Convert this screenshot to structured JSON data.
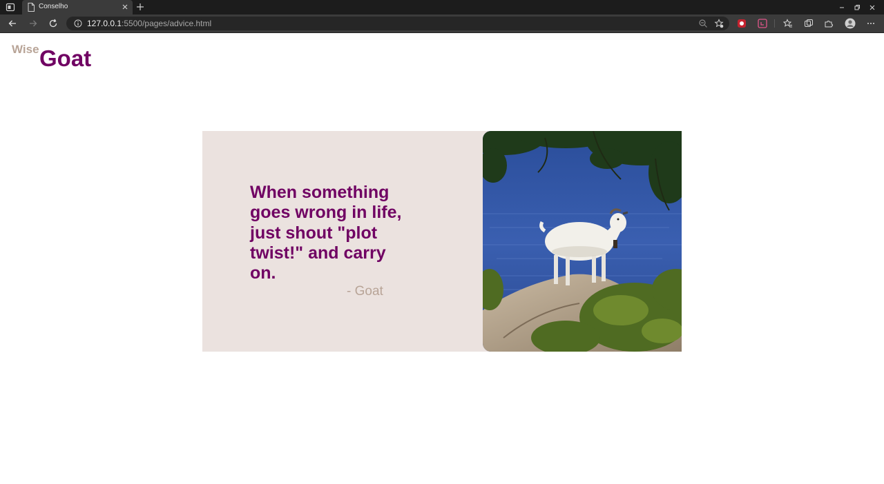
{
  "browser": {
    "tab": {
      "title": "Conselho"
    },
    "address": {
      "host": "127.0.0.1",
      "rest": ":5500/pages/advice.html"
    }
  },
  "header": {
    "logo_small": "Wise",
    "logo_big": "Goat"
  },
  "card": {
    "quote": "When something goes wrong in life, just shout \"plot twist!\" and carry on.",
    "author": "- Goat",
    "image": "goat-on-rock-by-sea-image"
  },
  "colors": {
    "brand_purple": "#700263",
    "accent_tan": "#b8a497",
    "card_bg": "#ebe2df"
  }
}
